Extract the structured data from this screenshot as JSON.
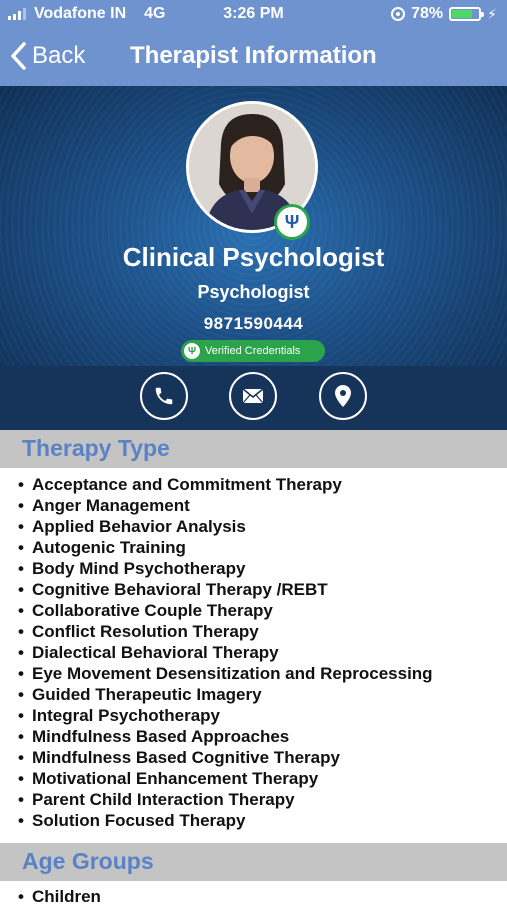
{
  "status_bar": {
    "carrier": "Vodafone IN",
    "network": "4G",
    "time": "3:26 PM",
    "battery": "78%",
    "battery_level": 0.78
  },
  "nav": {
    "back_label": "Back",
    "title": "Therapist Information"
  },
  "profile": {
    "title": "Clinical Psychologist",
    "subtitle": "Psychologist",
    "phone": "9871590444",
    "verified_label": "Verified Credentials",
    "badge_symbol": "Ψ"
  },
  "actions": [
    {
      "name": "call",
      "icon": "phone-icon"
    },
    {
      "name": "email",
      "icon": "mail-icon"
    },
    {
      "name": "location",
      "icon": "location-pin-icon"
    }
  ],
  "therapy_type": {
    "heading": "Therapy Type",
    "items": [
      "Acceptance and Commitment Therapy",
      "Anger Management",
      "Applied Behavior Analysis",
      "Autogenic Training",
      "Body Mind Psychotherapy",
      "Cognitive Behavioral Therapy /REBT",
      "Collaborative Couple Therapy",
      "Conflict Resolution Therapy",
      "Dialectical Behavioral Therapy",
      "Eye Movement Desensitization and Reprocessing",
      "Guided Therapeutic Imagery",
      "Integral Psychotherapy",
      "Mindfulness Based Approaches",
      "Mindfulness Based Cognitive Therapy",
      "Motivational Enhancement Therapy",
      "Parent Child Interaction Therapy",
      "Solution Focused Therapy"
    ]
  },
  "age_groups": {
    "heading": "Age Groups",
    "items": [
      "Children"
    ]
  },
  "colors": {
    "nav_bar": "#6f93cf",
    "section_heading": "#5b82c5",
    "section_bg": "#c4c4c4",
    "verified_green": "#2aa34a",
    "actions_bg": "#16335a"
  }
}
